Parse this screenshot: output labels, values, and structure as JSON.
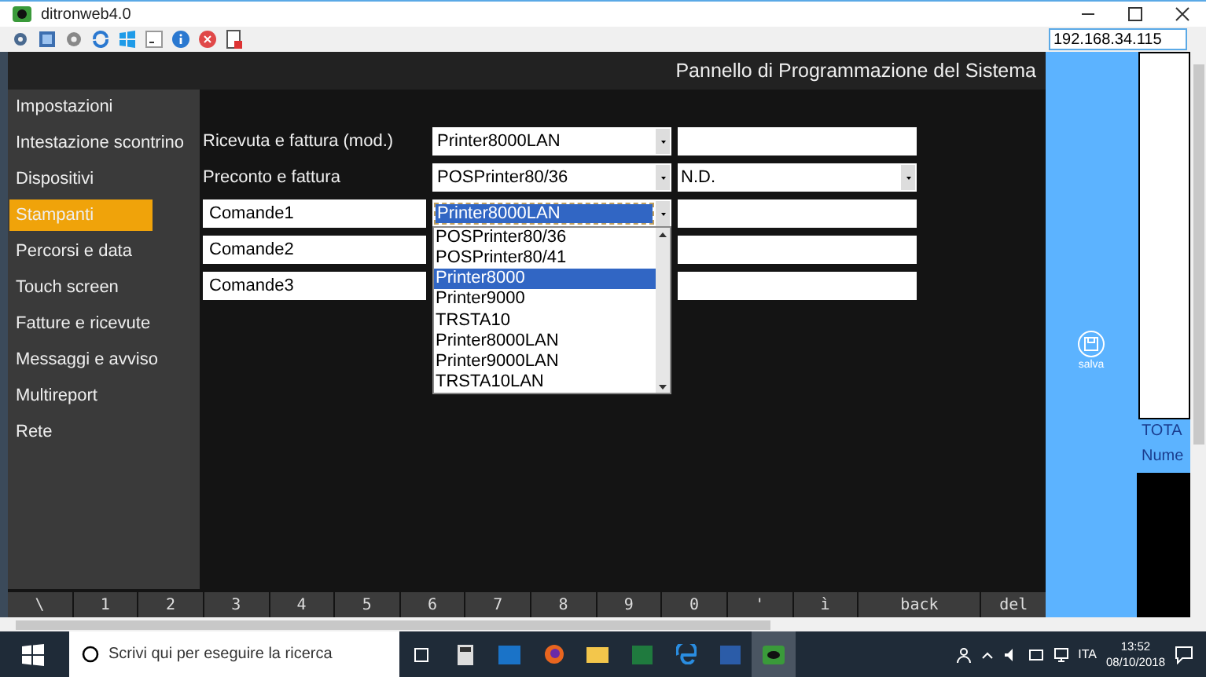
{
  "window": {
    "title": "ditronweb4.0"
  },
  "address": {
    "value": "192.168.34.115"
  },
  "header": {
    "title": "Pannello di Programmazione del Sistema"
  },
  "sidebar": {
    "items": [
      {
        "label": "Impostazioni",
        "selected": false
      },
      {
        "label": "Intestazione scontrino",
        "selected": false
      },
      {
        "label": "Dispositivi",
        "selected": false
      },
      {
        "label": "Stampanti",
        "selected": true
      },
      {
        "label": "Percorsi e data",
        "selected": false
      },
      {
        "label": "Touch screen",
        "selected": false
      },
      {
        "label": "Fatture e ricevute",
        "selected": false
      },
      {
        "label": "Messaggi e avviso",
        "selected": false
      },
      {
        "label": "Multireport",
        "selected": false
      },
      {
        "label": "Rete",
        "selected": false
      }
    ]
  },
  "rows": [
    {
      "name": {
        "kind": "text",
        "value": "Ricevuta e fattura (mod.)"
      },
      "printer": {
        "kind": "select",
        "value": "Printer8000LAN"
      },
      "extra": {
        "kind": "field"
      }
    },
    {
      "name": {
        "kind": "text",
        "value": "Preconto e fattura"
      },
      "printer": {
        "kind": "select",
        "value": "POSPrinter80/36"
      },
      "extra": {
        "kind": "select",
        "value": "N.D."
      }
    },
    {
      "name": {
        "kind": "field",
        "value": "Comande1"
      },
      "printer": {
        "kind": "select",
        "value": "Printer8000LAN",
        "expanded": true
      },
      "extra": {
        "kind": "field"
      }
    },
    {
      "name": {
        "kind": "field",
        "value": "Comande2"
      },
      "printer": {
        "kind": "select"
      },
      "extra": {
        "kind": "field"
      }
    },
    {
      "name": {
        "kind": "field",
        "value": "Comande3"
      },
      "printer": {
        "kind": "select"
      },
      "extra": {
        "kind": "field"
      }
    }
  ],
  "dropdown": {
    "options": [
      {
        "label": "POSPrinter80/36",
        "selected": false
      },
      {
        "label": "POSPrinter80/41",
        "selected": false
      },
      {
        "label": "Printer8000",
        "selected": true
      },
      {
        "label": "Printer9000",
        "selected": false
      },
      {
        "label": "TRSTA10",
        "selected": false
      },
      {
        "label": "Printer8000LAN",
        "selected": false
      },
      {
        "label": "Printer9000LAN",
        "selected": false
      },
      {
        "label": "TRSTA10LAN",
        "selected": false
      }
    ]
  },
  "save_button": {
    "label": "salva"
  },
  "side_panel": {
    "lines": [
      "TOTA",
      "Nume"
    ]
  },
  "keys": [
    {
      "label": "\\"
    },
    {
      "label": "1"
    },
    {
      "label": "2"
    },
    {
      "label": "3"
    },
    {
      "label": "4"
    },
    {
      "label": "5"
    },
    {
      "label": "6"
    },
    {
      "label": "7"
    },
    {
      "label": "8"
    },
    {
      "label": "9"
    },
    {
      "label": "0"
    },
    {
      "label": "'"
    },
    {
      "label": "ì"
    },
    {
      "label": "back",
      "kind": "wide"
    },
    {
      "label": "del"
    }
  ],
  "taskbar": {
    "search_placeholder": "Scrivi qui per eseguire la ricerca",
    "language": "ITA",
    "time": "13:52",
    "date": "08/10/2018"
  }
}
